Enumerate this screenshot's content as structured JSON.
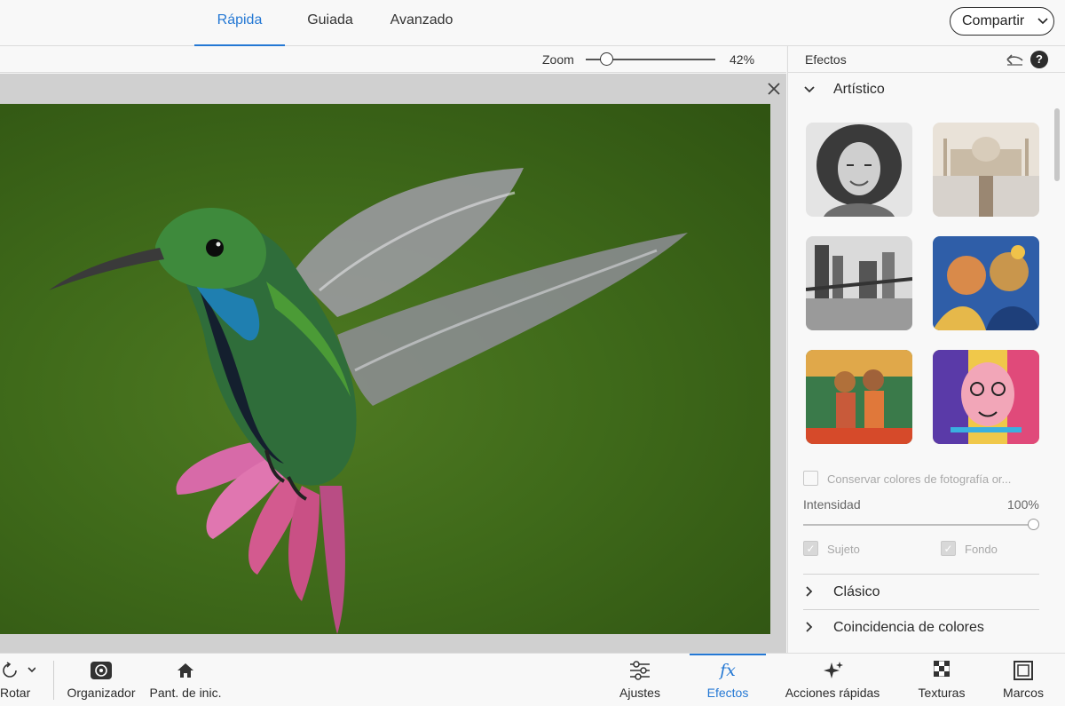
{
  "mode_tabs": [
    {
      "label": "Rápida",
      "active": true
    },
    {
      "label": "Guiada",
      "active": false
    },
    {
      "label": "Avanzado",
      "active": false
    }
  ],
  "share": {
    "label": "Compartir"
  },
  "zoom": {
    "label": "Zoom",
    "value": "42%",
    "fraction": 0.42
  },
  "panel": {
    "title": "Efectos",
    "sections": {
      "artistic": "Artístico",
      "classic": "Clásico",
      "color_match": "Coincidencia de colores"
    },
    "thumbnails": [
      "portrait-sketch",
      "taj-mahal",
      "london-bw",
      "painted-couple",
      "tahitian-women",
      "abstract-face"
    ],
    "preserve_colors": "Conservar colores de fotografía or...",
    "intensity_label": "Intensidad",
    "intensity_value": "100%",
    "intensity_fraction": 1.0,
    "subject_label": "Sujeto",
    "background_label": "Fondo"
  },
  "bottom_tools": {
    "rotate": "Rotar",
    "organizer": "Organizador",
    "home": "Pant. de inic.",
    "adjustments": "Ajustes",
    "effects": "Efectos",
    "quick_actions": "Acciones rápidas",
    "textures": "Texturas",
    "frames": "Marcos"
  },
  "colors": {
    "accent": "#2478d4",
    "canvas_bg": "#d0d0d0",
    "photo_bg": "#3f6a1a"
  }
}
